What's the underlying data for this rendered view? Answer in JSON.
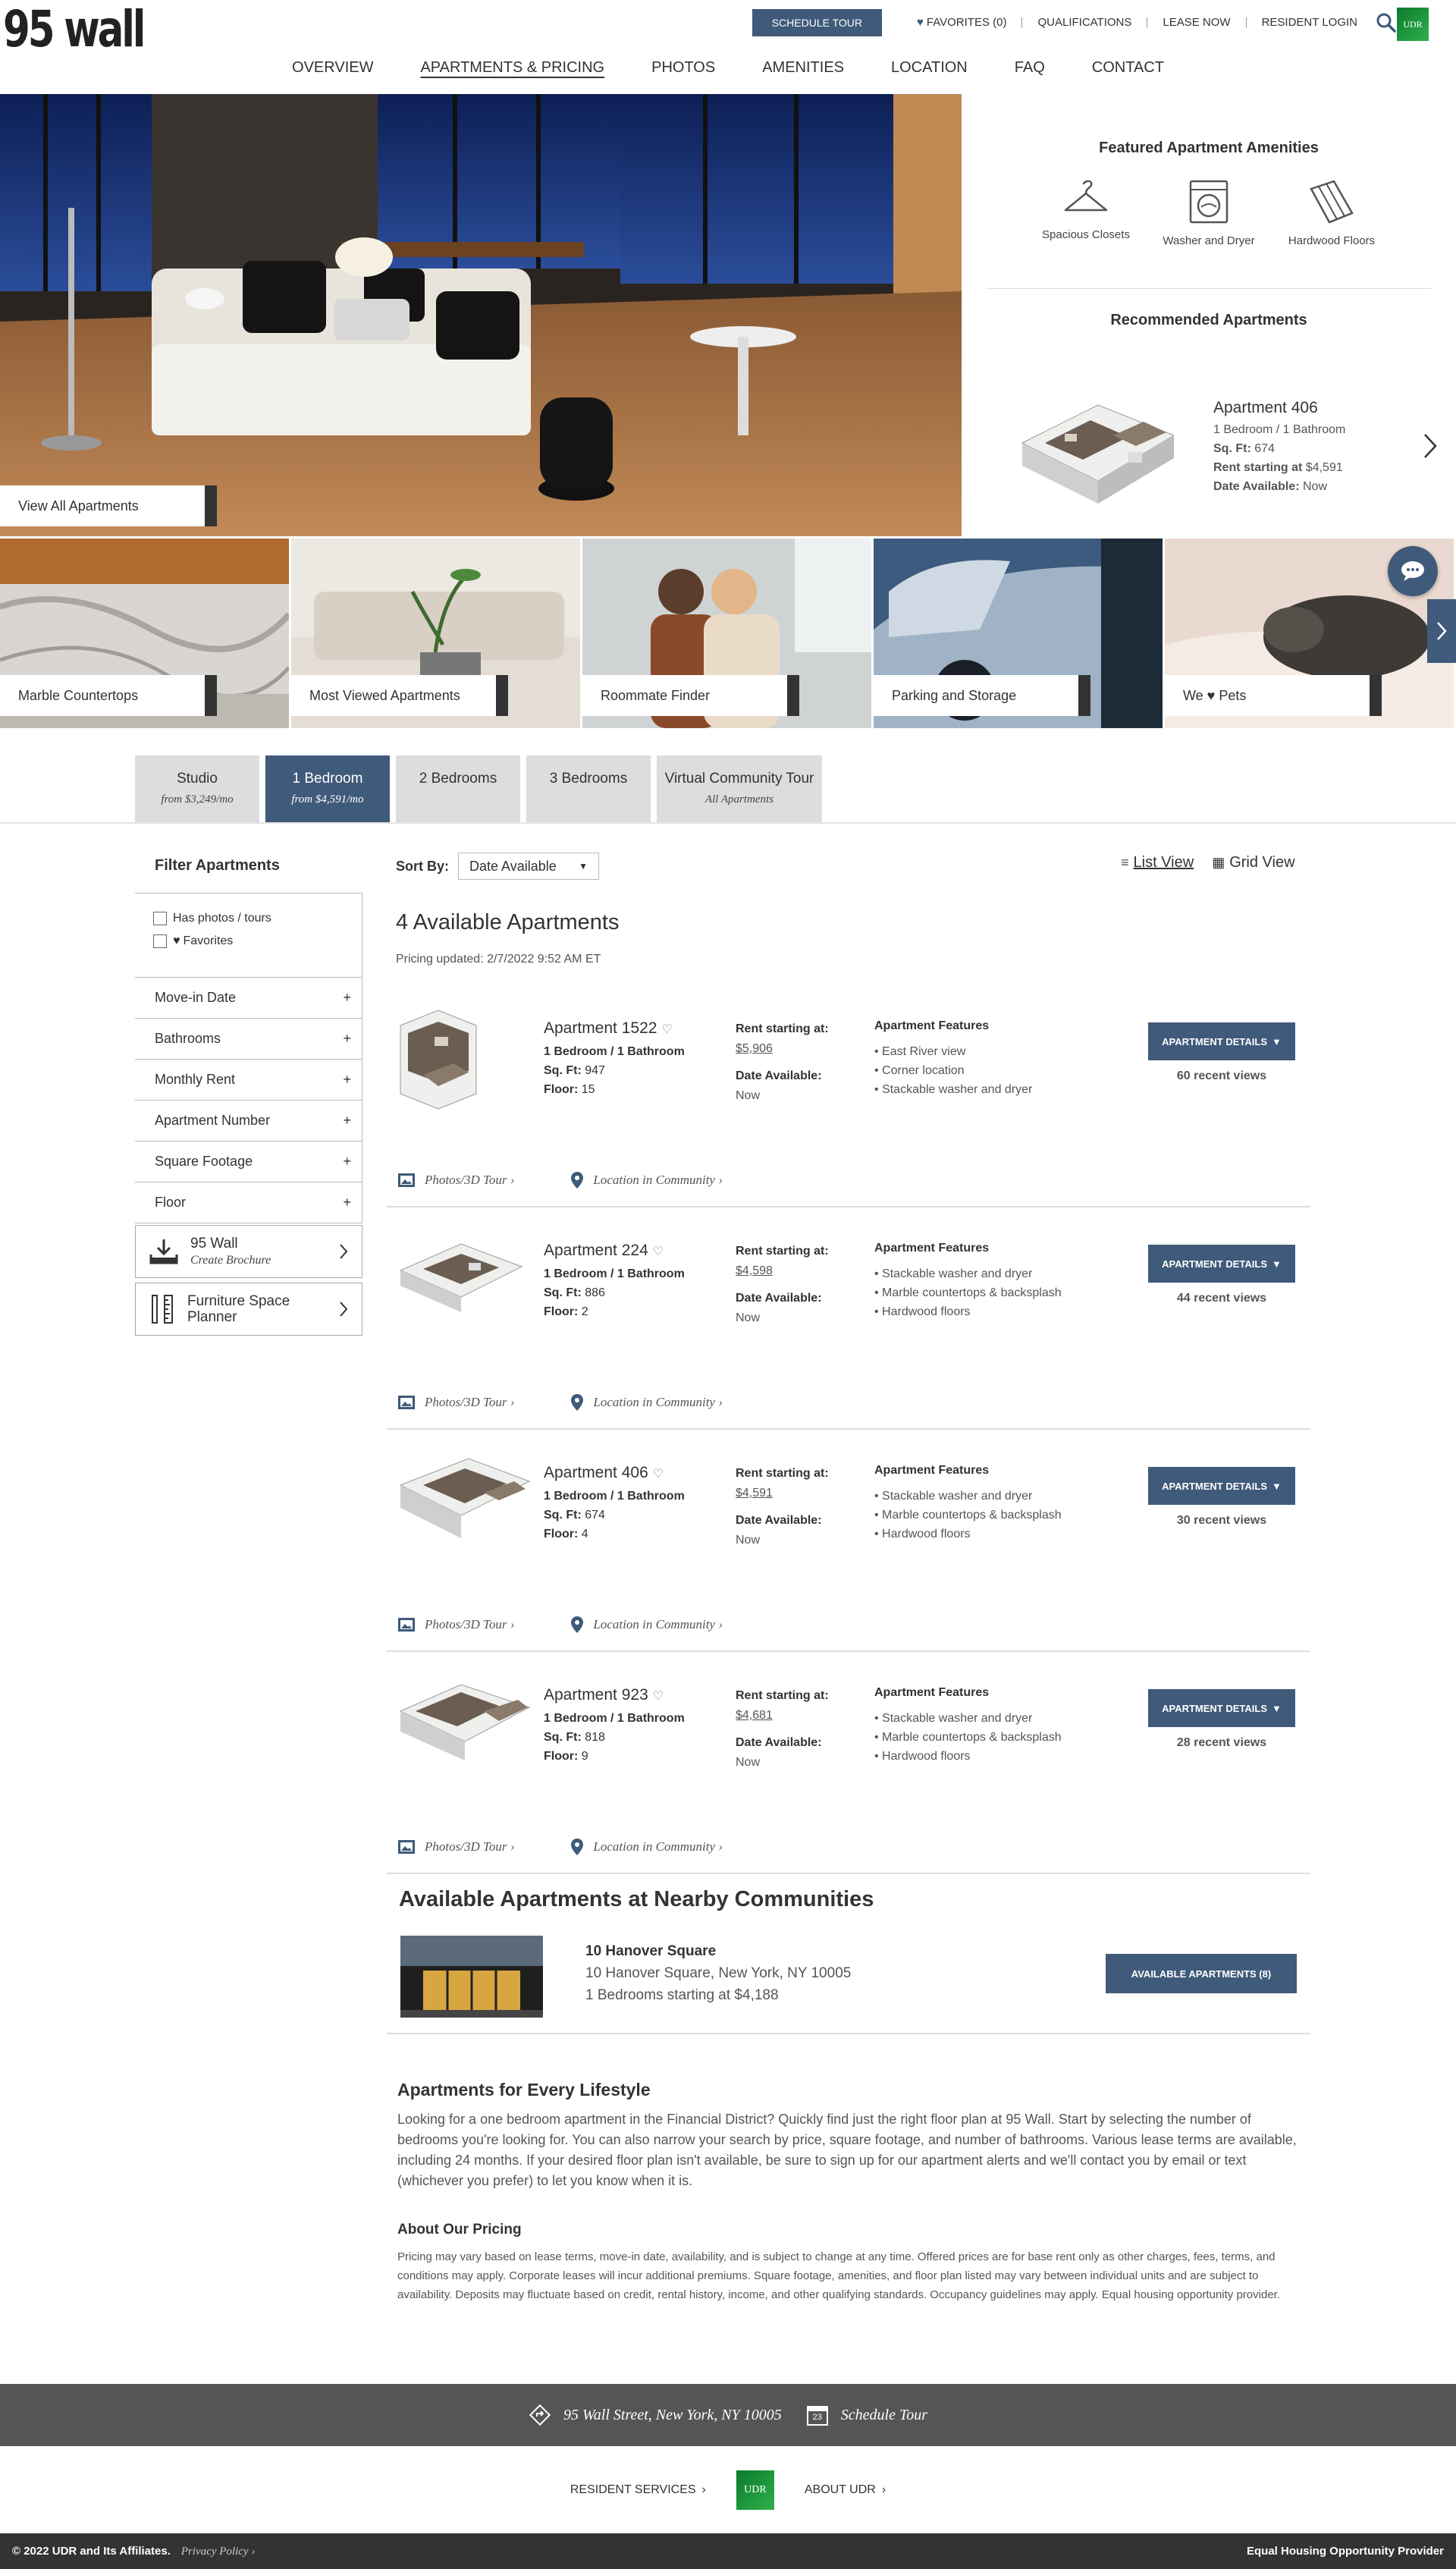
{
  "header": {
    "logo_text": "95 wall",
    "schedule_tour": "SCHEDULE TOUR",
    "favorites": "FAVORITES (0)",
    "qualifications": "QUALIFICATIONS",
    "lease_now": "LEASE NOW",
    "resident_login": "RESIDENT LOGIN",
    "udr_badge": "UDR"
  },
  "nav": [
    "OVERVIEW",
    "APARTMENTS & PRICING",
    "PHOTOS",
    "AMENITIES",
    "LOCATION",
    "FAQ",
    "CONTACT"
  ],
  "hero": {
    "view_all": "View All Apartments"
  },
  "featured": {
    "title": "Featured Apartment Amenities",
    "items": [
      "Spacious Closets",
      "Washer and Dryer",
      "Hardwood Floors"
    ]
  },
  "recommended": {
    "title": "Recommended Apartments",
    "name": "Apartment 406",
    "beds": "1 Bedroom / 1 Bathroom",
    "sqft_label": "Sq. Ft:",
    "sqft": "674",
    "rent_label": "Rent starting at",
    "rent": "$4,591",
    "date_label": "Date Available:",
    "date": "Now"
  },
  "categories": [
    "Marble Countertops",
    "Most Viewed Apartments",
    "Roommate Finder",
    "Parking and Storage",
    "We ♥ Pets"
  ],
  "tabs": [
    {
      "label": "Studio",
      "sub": "from $3,249/mo"
    },
    {
      "label": "1 Bedroom",
      "sub": "from $4,591/mo"
    },
    {
      "label": "2 Bedrooms",
      "sub": ""
    },
    {
      "label": "3 Bedrooms",
      "sub": ""
    },
    {
      "label": "Virtual Community Tour",
      "sub": "All Apartments"
    }
  ],
  "filters": {
    "title": "Filter Apartments",
    "has_photos": "Has photos / tours",
    "favorites": "Favorites",
    "accordions": [
      "Move-in Date",
      "Bathrooms",
      "Monthly Rent",
      "Apartment Number",
      "Square Footage",
      "Floor"
    ],
    "brochure_title": "95 Wall",
    "brochure_sub": "Create Brochure",
    "planner": "Furniture Space Planner"
  },
  "sort": {
    "label": "Sort By:",
    "value": "Date Available"
  },
  "views": {
    "list": "List View",
    "grid": "Grid View"
  },
  "results": {
    "count": "4 Available Apartments",
    "updated": "Pricing updated: 2/7/2022 9:52 AM ET"
  },
  "listing_labels": {
    "beds": "1 Bedroom / 1 Bathroom",
    "sqft": "Sq. Ft:",
    "floor": "Floor:",
    "rent": "Rent starting at:",
    "date": "Date Available:",
    "features": "Apartment Features",
    "details_btn": "APARTMENT DETAILS",
    "photos": "Photos/3D Tour",
    "location": "Location in Community"
  },
  "listings": [
    {
      "name": "Apartment 1522",
      "sqft": "947",
      "floor": "15",
      "rent": "$5,906",
      "date": "Now",
      "features": [
        "East River view",
        "Corner location",
        "Stackable washer and dryer"
      ],
      "views": "60 recent views"
    },
    {
      "name": "Apartment 224",
      "sqft": "886",
      "floor": "2",
      "rent": "$4,598",
      "date": "Now",
      "features": [
        "Stackable washer and dryer",
        "Marble countertops & backsplash",
        "Hardwood floors"
      ],
      "views": "44 recent views"
    },
    {
      "name": "Apartment 406",
      "sqft": "674",
      "floor": "4",
      "rent": "$4,591",
      "date": "Now",
      "features": [
        "Stackable washer and dryer",
        "Marble countertops & backsplash",
        "Hardwood floors"
      ],
      "views": "30 recent views"
    },
    {
      "name": "Apartment 923",
      "sqft": "818",
      "floor": "9",
      "rent": "$4,681",
      "date": "Now",
      "features": [
        "Stackable washer and dryer",
        "Marble countertops & backsplash",
        "Hardwood floors"
      ],
      "views": "28 recent views"
    }
  ],
  "nearby": {
    "title": "Available Apartments at Nearby Communities",
    "name": "10 Hanover Square",
    "address": "10 Hanover Square, New York, NY 10005",
    "starting": "1 Bedrooms starting at $4,188",
    "button": "AVAILABLE APARTMENTS (8)"
  },
  "copy": {
    "title": "Apartments for Every Lifestyle",
    "body": "Looking for a one bedroom apartment in the Financial District? Quickly find just the right floor plan at 95 Wall. Start by selecting the number of bedrooms you're looking for. You can also narrow your search by price, square footage, and number of bathrooms. Various lease terms are available, including 24 months. If your desired floor plan isn't available, be sure to sign up for our apartment alerts and we'll contact you by email or text (whichever you prefer) to let you know when it is.",
    "pricing_title": "About Our Pricing",
    "pricing_body": "Pricing may vary based on lease terms, move-in date, availability, and is subject to change at any time. Offered prices are for base rent only as other charges, fees, terms, and conditions may apply. Corporate leases will incur additional premiums. Square footage, amenities, and floor plan listed may vary between individual units and are subject to availability. Deposits may fluctuate based on credit, rental history, income, and other qualifying standards. Occupancy guidelines may apply. Equal housing opportunity provider."
  },
  "footer": {
    "address": "95 Wall Street, New York, NY 10005",
    "calendar_day": "23",
    "schedule": "Schedule Tour",
    "resident_services": "RESIDENT SERVICES",
    "udr": "UDR",
    "about": "ABOUT UDR",
    "copyright": "© 2022 UDR and Its Affiliates.",
    "privacy": "Privacy Policy",
    "equal": "Equal Housing Opportunity Provider"
  },
  "colors": {
    "accent": "#3f5a7a",
    "udr_green": "#1f9a3f",
    "footer_dark": "#333333",
    "footer_mid": "#555555"
  }
}
